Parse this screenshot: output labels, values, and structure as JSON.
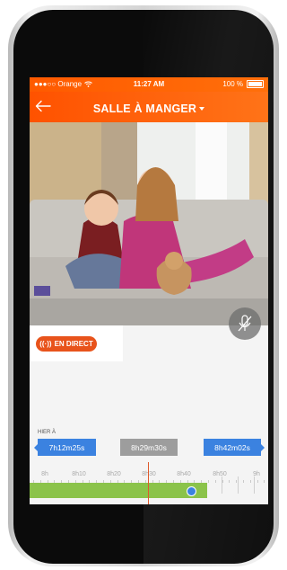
{
  "status_bar": {
    "carrier": "●●●○○ Orange",
    "time": "11:27 AM",
    "battery": "100 %"
  },
  "header": {
    "title": "SALLE À MANGER"
  },
  "live_button": {
    "label": "EN DIRECT"
  },
  "timeline": {
    "day_label": "HIER À",
    "start_time": "7h12m25s",
    "current_time": "8h29m30s",
    "end_time": "8h42m02s",
    "ticks": [
      "8h",
      "8h10",
      "8h20",
      "8h30",
      "8h40",
      "8h50",
      "9h"
    ]
  },
  "colors": {
    "brand": "#ff5a00",
    "chip_blue": "#3b82e0",
    "recorded_green": "#8bc34a",
    "cursor_orange": "#e05a2b"
  }
}
